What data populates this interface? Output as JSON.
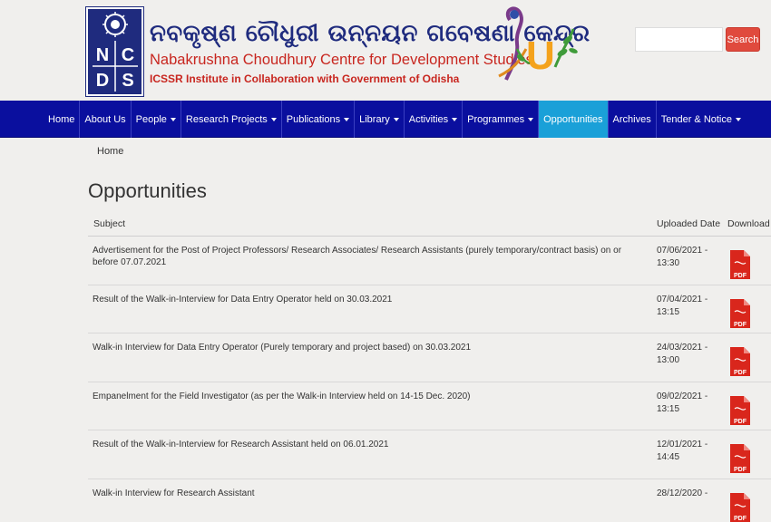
{
  "header": {
    "logo_letters": [
      "N",
      "C",
      "D",
      "S"
    ],
    "org_name_odia": "ନବକୃଷ୍ଣ ଚୌଧୁରୀ ଉନ୍ନୟନ ଗବେଷଣା କେନ୍ଦ୍ର",
    "org_name_en": "Nabakrushna Choudhury Centre for Development Studies",
    "org_subtitle": "ICSSR Institute in Collaboration with Government of Odisha",
    "emblem_text": "U",
    "search_placeholder": "",
    "search_button": "Search"
  },
  "nav": {
    "items": [
      {
        "label": "Home",
        "dropdown": false
      },
      {
        "label": "About Us",
        "dropdown": false
      },
      {
        "label": "People",
        "dropdown": true
      },
      {
        "label": "Research Projects",
        "dropdown": true
      },
      {
        "label": "Publications",
        "dropdown": true
      },
      {
        "label": "Library",
        "dropdown": true
      },
      {
        "label": "Activities",
        "dropdown": true
      },
      {
        "label": "Programmes",
        "dropdown": true
      },
      {
        "label": "Opportunities",
        "dropdown": false,
        "active": true
      },
      {
        "label": "Archives",
        "dropdown": false
      },
      {
        "label": "Tender & Notice",
        "dropdown": true
      }
    ]
  },
  "breadcrumb": "Home",
  "page_title": "Opportunities",
  "table": {
    "headers": {
      "subject": "Subject",
      "uploaded": "Uploaded Date",
      "download": "Download"
    },
    "rows": [
      {
        "subject": "Advertisement for the Post of Project Professors/ Research Associates/ Research Assistants (purely temporary/contract basis) on or before 07.07.2021",
        "date": "07/06/2021 -",
        "time": "13:30"
      },
      {
        "subject": "Result of the Walk-in-Interview for Data Entry Operator held on 30.03.2021",
        "date": "07/04/2021 -",
        "time": "13:15"
      },
      {
        "subject": "Walk-in Interview for Data Entry Operator (Purely temporary and project based) on 30.03.2021",
        "date": "24/03/2021 -",
        "time": "13:00"
      },
      {
        "subject": "Empanelment for the Field Investigator (as per the Walk-in Interview held on 14-15 Dec. 2020)",
        "date": "09/02/2021 -",
        "time": "13:15"
      },
      {
        "subject": "Result of the Walk-in-Interview for Research Assistant held on 06.01.2021",
        "date": "12/01/2021 -",
        "time": "14:45"
      },
      {
        "subject": "Walk-in Interview for Research Assistant",
        "date": "28/12/2020 -",
        "time": ""
      }
    ],
    "pdf_label": "PDF"
  },
  "colors": {
    "nav_bg": "#0a0f9e",
    "nav_active": "#1aa0d8",
    "brand_blue": "#1f2b7e",
    "brand_red": "#c8261f",
    "search_btn": "#e04a3d",
    "pdf_red": "#d9261c"
  }
}
